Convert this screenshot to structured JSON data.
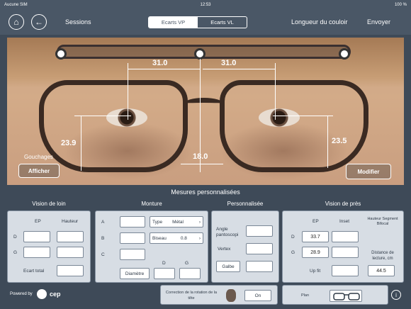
{
  "status": {
    "carrier": "Aucune SIM",
    "time": "12:53",
    "battery": "100 %"
  },
  "nav": {
    "sessions": "Sessions",
    "tabs": [
      {
        "label": "Ecarts VP",
        "active": true
      },
      {
        "label": "Ecarts VL",
        "active": false
      }
    ],
    "corridor": "Longueur du couloir",
    "send": "Envoyer"
  },
  "photo": {
    "top_left": "31.0",
    "top_right": "31.0",
    "height_left": "23.9",
    "height_right": "23.5",
    "bridge": "18.0",
    "gouchages": "Gouchages",
    "afficher": "Afficher",
    "modifier": "Modifier"
  },
  "panel": {
    "title": "Mesures personnalisées",
    "vision_loin": {
      "title": "Vision de loin",
      "col_ep": "EP",
      "col_hauteur": "Hauteur",
      "row_d": "D",
      "row_g": "G",
      "ecart_total": "Ecart total"
    },
    "monture": {
      "title": "Monture",
      "row_a": "A",
      "row_b": "B",
      "row_c": "C",
      "type_label": "Type",
      "type_value": "Métal",
      "biseau_label": "Biseau",
      "biseau_value": "0.8",
      "diametre": "Diamètre",
      "col_d": "D",
      "col_g": "G"
    },
    "personnalisee": {
      "title": "Personnalisée",
      "angle": "Angle pantoscopi",
      "vertex": "Vertex",
      "galbe": "Galbe"
    },
    "vision_pres": {
      "title": "Vision de près",
      "col_ep": "EP",
      "col_inset": "Inset",
      "col_hauteur": "Hauteur Segment Bifocal",
      "row_d": "D",
      "row_g": "G",
      "ep_d": "33.7",
      "ep_g": "28.9",
      "distance": "Distance de lecture, cm",
      "distance_value": "44.5",
      "upfit": "Up fit"
    }
  },
  "footer": {
    "powered": "Powered by",
    "brand": "cep",
    "rotation": "Correction de la rotation de la tête",
    "on": "On",
    "plan": "Plan"
  }
}
